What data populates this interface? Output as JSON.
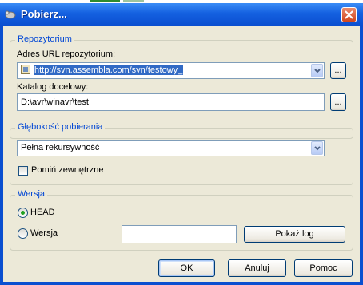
{
  "window": {
    "title": "Pobierz..."
  },
  "repository": {
    "legend": "Repozytorium",
    "url_label": "Adres URL repozytorium:",
    "url_value": "http://svn.assembla.com/svn/testowy_",
    "browse_label": "...",
    "target_label": "Katalog docelowy:",
    "target_value": "D:\\avr\\winavr\\test",
    "target_browse_label": "..."
  },
  "depth": {
    "legend": "Głębokość pobierania",
    "selected": "Pełna rekursywność",
    "omit_externals_label": "Pomiń zewnętrzne",
    "omit_externals_checked": false
  },
  "revision": {
    "legend": "Wersja",
    "head_label": "HEAD",
    "head_selected": true,
    "revision_label": "Wersja",
    "revision_selected": false,
    "revision_value": "",
    "show_log_label": "Pokaż log"
  },
  "footer": {
    "ok_label": "OK",
    "cancel_label": "Anuluj",
    "help_label": "Pomoc"
  }
}
